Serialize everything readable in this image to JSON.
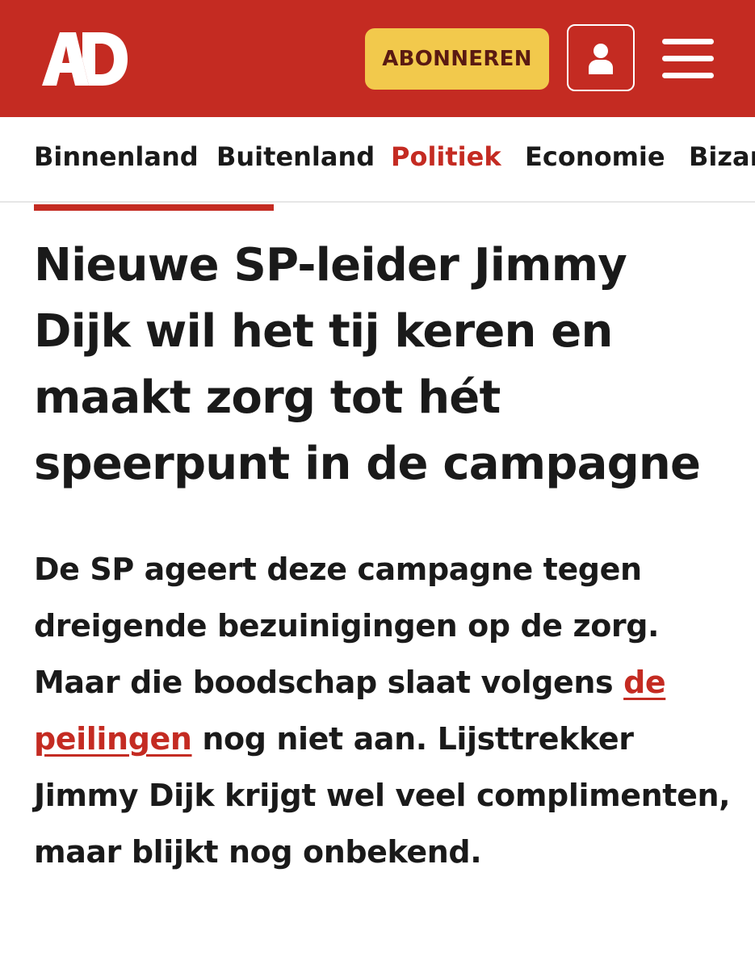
{
  "header": {
    "logo_text": "AD",
    "subscribe_label": "ABONNEREN",
    "account_icon": "user-icon",
    "menu_icon": "hamburger-menu-icon",
    "brand_color": "#c42b22",
    "subscribe_color": "#f2c94c"
  },
  "nav": {
    "items": [
      {
        "label": "Binnenland",
        "active": false
      },
      {
        "label": "Buitenland",
        "active": false
      },
      {
        "label": "Politiek",
        "active": true
      },
      {
        "label": "Economie",
        "active": false
      },
      {
        "label": "Bizar",
        "active": false
      }
    ]
  },
  "article": {
    "headline": "Nieuwe SP-leider Jimmy Dijk wil het tij keren en maakt zorg tot hét speerpunt in de campagne",
    "intro_part1": "De SP ageert deze campagne tegen dreigende bezuinigingen op de zorg. Maar die boodschap slaat volgens ",
    "intro_link": "de peilingen",
    "intro_part2": " nog niet aan. Lijsttrekker Jimmy Dijk krijgt wel veel complimenten, maar blijkt nog onbekend."
  }
}
